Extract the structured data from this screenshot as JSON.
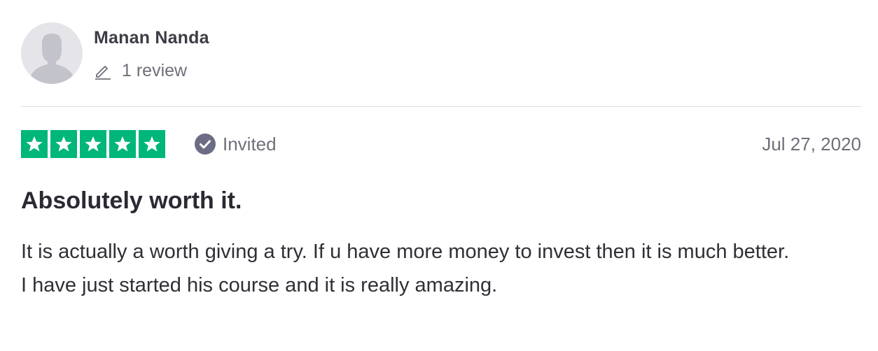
{
  "reviewer": {
    "name": "Manan Nanda",
    "review_count": "1 review",
    "avatar_icon": "user-silhouette-icon",
    "pen_icon": "pen-icon"
  },
  "review": {
    "rating": 5,
    "rating_max": 5,
    "star_color": "#00b67a",
    "badge": "Invited",
    "badge_icon": "check-circle-icon",
    "date": "Jul 27, 2020",
    "title": "Absolutely worth it.",
    "body": [
      "It is actually a worth giving a try. If u have more money to invest then it is much better.",
      "I have just started his course and it is really amazing."
    ]
  }
}
